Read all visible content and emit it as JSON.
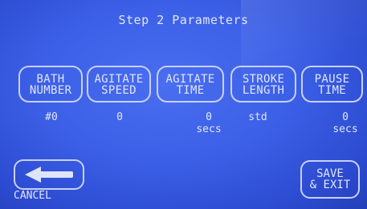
{
  "header": {
    "title": "Step 2 Parameters"
  },
  "parameters": [
    {
      "label": "BATH\nNUMBER",
      "value": "#0"
    },
    {
      "label": "AGITATE\nSPEED",
      "value": "0"
    },
    {
      "label": "AGITATE\nTIME",
      "value": "0\nsecs"
    },
    {
      "label": "STROKE\nLENGTH",
      "value": "std"
    },
    {
      "label": "PAUSE\nTIME",
      "value": "0\nsecs"
    }
  ],
  "footer": {
    "back_icon": "arrow-left-icon",
    "cancel_label": "CANCEL",
    "save_label": "SAVE\n& EXIT"
  },
  "colors": {
    "screen_bg": "#3b5fe6",
    "outline": "#c8d0f5",
    "text": "#e2e6fb"
  }
}
